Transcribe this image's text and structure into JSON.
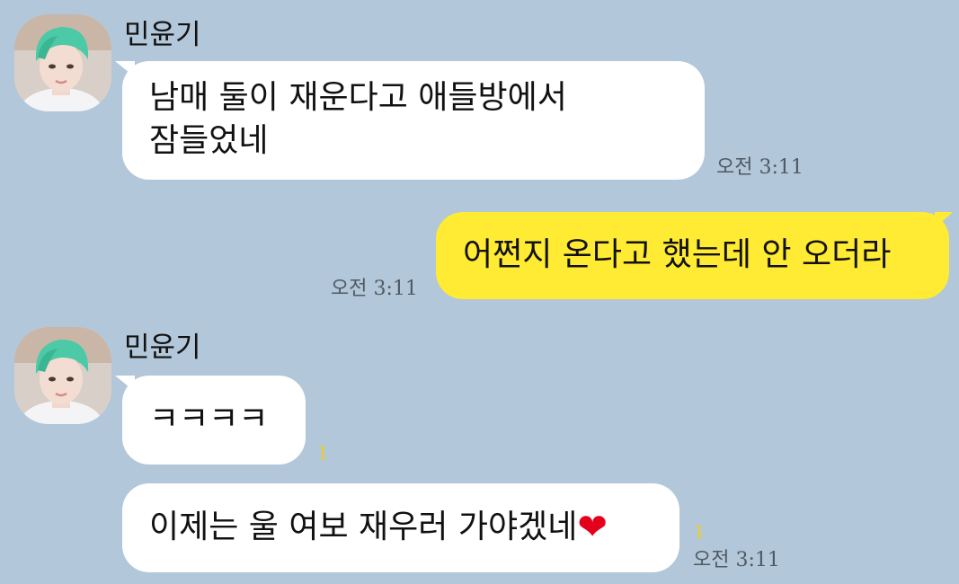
{
  "contact": {
    "name": "민윤기"
  },
  "messages": [
    {
      "direction": "incoming",
      "line1": "남매 둘이 재운다고 애들방에서",
      "line2": "잠들었네",
      "time": "오전 3:11"
    },
    {
      "direction": "outgoing",
      "text": "어쩐지 온다고 했는데 안 오더라",
      "time": "오전 3:11"
    },
    {
      "direction": "incoming",
      "text": "ㅋㅋㅋㅋ",
      "unread": "1"
    },
    {
      "direction": "incoming",
      "text": "이제는 울 여보 재우러 가야겠네",
      "emoji": "❤",
      "unread": "1",
      "time": "오전 3:11"
    }
  ],
  "colors": {
    "background": "#b2c7d9",
    "incoming_bubble": "#ffffff",
    "outgoing_bubble": "#ffeb33",
    "unread": "#f2cf1c"
  },
  "icons": {
    "avatar": "profile-photo"
  }
}
